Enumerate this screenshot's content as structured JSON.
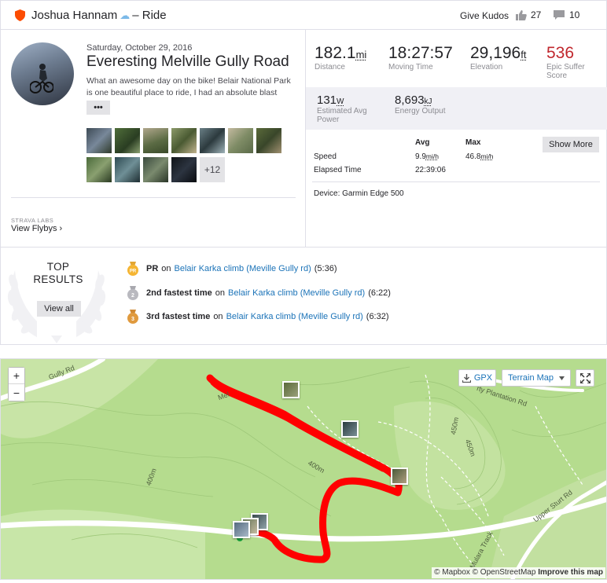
{
  "header": {
    "athlete_name": "Joshua Hannam",
    "separator": "– Ride",
    "give_kudos_label": "Give Kudos",
    "kudos_count": "27",
    "comment_count": "10"
  },
  "activity": {
    "date": "Saturday, October 29, 2016",
    "name": "Everesting Melville Gully Road",
    "description": "What an awesome day on the bike! Belair National Park is one beautiful place to ride, I had an absolute blast",
    "more_label": "•••",
    "photo_more_label": "+12",
    "labs_label": "STRAVA LABS",
    "view_flybys_label": "View Flybys ›"
  },
  "stats": {
    "distance": {
      "value": "182.1",
      "unit": "mi",
      "label": "Distance"
    },
    "moving_time": {
      "value": "18:27:57",
      "label": "Moving Time"
    },
    "elevation": {
      "value": "29,196",
      "unit": "ft",
      "label": "Elevation"
    },
    "suffer": {
      "value": "536",
      "label_line1": "Epic Suffer",
      "label_line2": "Score"
    },
    "power": {
      "value": "131",
      "unit": "W",
      "label_line1": "Estimated Avg",
      "label_line2": "Power"
    },
    "energy": {
      "value": "8,693",
      "unit": "kJ",
      "label": "Energy Output"
    },
    "show_more_label": "Show More",
    "table": {
      "avg_header": "Avg",
      "max_header": "Max",
      "speed_label": "Speed",
      "speed_avg": "9.9",
      "speed_max": "46.8",
      "speed_unit": "mi/h",
      "elapsed_label": "Elapsed Time",
      "elapsed_value": "22:39:06"
    },
    "device": "Device: Garmin Edge 500"
  },
  "results": {
    "title_line1": "TOP",
    "title_line2": "RESULTS",
    "view_all_label": "View all",
    "items": [
      {
        "rank": "PR",
        "connector": "on",
        "segment": "Belair Karka climb (Meville Gully rd)",
        "time": "(5:36)",
        "medal_label": "PR"
      },
      {
        "rank": "2nd fastest time",
        "connector": "on",
        "segment": "Belair Karka climb (Meville Gully rd)",
        "time": "(6:22)",
        "medal_label": "2"
      },
      {
        "rank": "3rd fastest time",
        "connector": "on",
        "segment": "Belair Karka climb (Meville Gully rd)",
        "time": "(6:32)",
        "medal_label": "3"
      }
    ]
  },
  "map": {
    "zoom_in_label": "+",
    "zoom_out_label": "−",
    "gpx_label": "GPX",
    "terrain_label": "Terrain Map",
    "attribution_mapbox": "© Mapbox © OpenStreetMap",
    "attribution_improve": "Improve this map",
    "labels": {
      "gully_rd": "Gully Rd",
      "plantation_rd": "rty Plantation Rd",
      "upper_sturt_rd": "Upper Sturt Rd",
      "mulara_track": "Mulara Track",
      "contour_450a": "450m",
      "contour_450b": "450m",
      "contour_400a": "400m",
      "contour_400b": "400m",
      "mel_fragment": "Mel"
    }
  },
  "colors": {
    "strava_orange": "#fc4c02",
    "suffer_red": "#c0272d",
    "link_blue": "#1b73b8",
    "route_red": "#ff0000",
    "map_green": "#b5dc8e"
  }
}
